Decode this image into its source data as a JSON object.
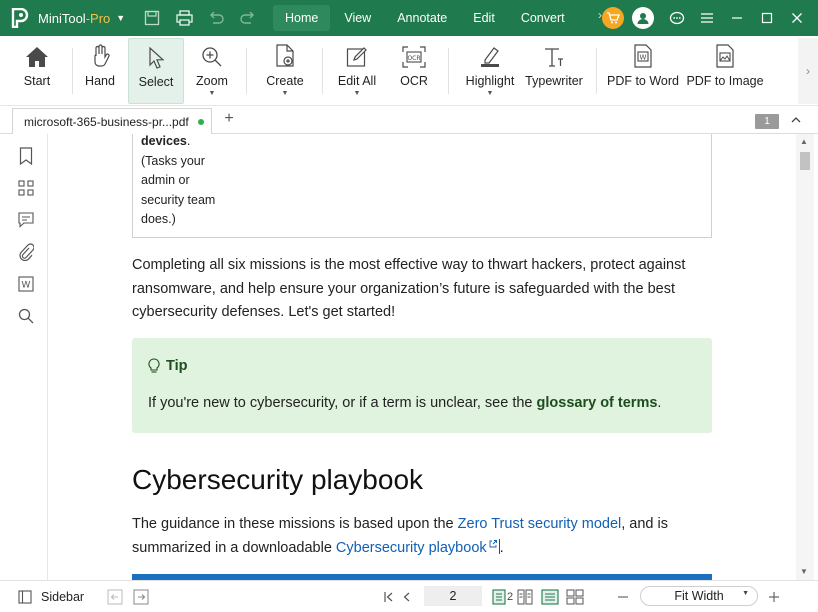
{
  "app": {
    "brand": "MiniTool",
    "brand_suffix": "-Pro"
  },
  "menu": {
    "tabs": [
      "Home",
      "View",
      "Annotate",
      "Edit",
      "Convert"
    ],
    "active": "Home"
  },
  "ribbon": {
    "start": "Start",
    "hand": "Hand",
    "select": "Select",
    "zoom": "Zoom",
    "create": "Create",
    "edit_all": "Edit All",
    "ocr": "OCR",
    "highlight": "Highlight",
    "typewriter": "Typewriter",
    "pdf_to_word": "PDF to Word",
    "pdf_to_image": "PDF to Image"
  },
  "document_tab": {
    "name": "microsoft-365-business-pr...pdf",
    "page_badge": "1"
  },
  "content": {
    "table_cell": {
      "bold": "devices",
      "bold_suffix": ".",
      "lines": [
        "(Tasks your",
        "admin or",
        "security team",
        "does.)"
      ]
    },
    "paragraph1": {
      "line1": "Completing all six missions is the most effective way to thwart hackers, protect against",
      "line2": "ransomware, and help ensure your organization’s future is safeguarded with the best",
      "line3": "cybersecurity defenses. Let's get started!"
    },
    "tip": {
      "title": "Tip",
      "text_before": "If you're new to cybersecurity, or if a term is unclear, see the ",
      "link": "glossary of terms",
      "text_after": "."
    },
    "heading": "Cybersecurity playbook",
    "paragraph2": {
      "text1": "The guidance in these missions is based upon the ",
      "link1": "Zero Trust security model",
      "text2": ", and is",
      "text3": "summarized in a downloadable ",
      "link2": "Cybersecurity playbook",
      "text4": "."
    }
  },
  "statusbar": {
    "sidebar_label": "Sidebar",
    "page_value": "2",
    "page_count": "2",
    "zoom_label": "Fit Width"
  },
  "colors": {
    "titlebar": "#1f7a4d",
    "accent": "#2bb24c",
    "link": "#1160b5",
    "tip_bg": "#dff3df"
  }
}
